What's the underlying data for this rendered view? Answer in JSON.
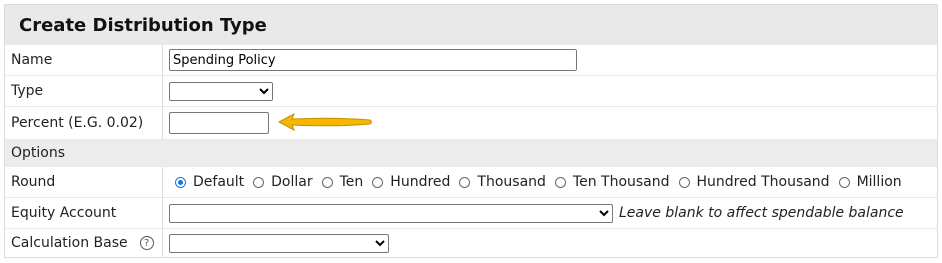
{
  "form": {
    "title": "Create Distribution Type",
    "name": {
      "label": "Name",
      "value": "Spending Policy"
    },
    "type": {
      "label": "Type",
      "value": ""
    },
    "percent": {
      "label": "Percent (E.G. 0.02)",
      "value": ""
    },
    "options_label": "Options",
    "round": {
      "label": "Round",
      "selected": "Default",
      "options": [
        "Default",
        "Dollar",
        "Ten",
        "Hundred",
        "Thousand",
        "Ten Thousand",
        "Hundred Thousand",
        "Million"
      ]
    },
    "equity_account": {
      "label": "Equity Account",
      "value": "",
      "hint": "Leave blank to affect spendable balance"
    },
    "calculation_base": {
      "label": "Calculation Base",
      "value": "",
      "help_icon": "question-circle-icon",
      "help_glyph": "?"
    }
  },
  "colors": {
    "arrow": "#f5b800",
    "radio_checked": "#1a73e8",
    "panel": "#e9e9e9"
  }
}
